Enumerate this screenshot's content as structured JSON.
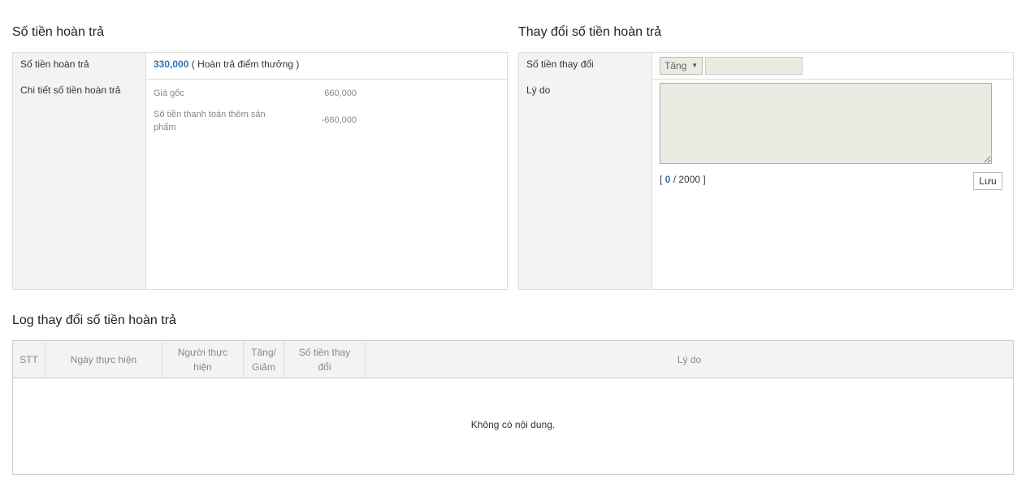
{
  "refund": {
    "title": "Số tiền hoàn trả",
    "amount_label": "Số tiền hoàn trả",
    "amount_value": "330,000",
    "amount_note": "( Hoàn trả điểm thưởng )",
    "detail_label": "Chi tiết số tiền hoàn trả",
    "details": [
      {
        "label": "Giá gốc",
        "value": "660,000"
      },
      {
        "label": "Số tiền thanh toán thêm sản phẩm",
        "value": "-660,000"
      }
    ]
  },
  "change": {
    "title": "Thay đổi số tiền hoàn trả",
    "amount_label": "Số tiền thay đổi",
    "direction_selected": "Tăng",
    "amount_input_value": "",
    "reason_label": "Lý do",
    "reason_value": "",
    "counter_current": "0",
    "counter_max": "2000",
    "save_label": "Lưu"
  },
  "log": {
    "title": "Log thay đổi số tiền hoàn trả",
    "columns": [
      "STT",
      "Ngày thực hiện",
      "Người thực hiện",
      "Tăng/ Giảm",
      "Số tiền thay đổi",
      "Lý do"
    ],
    "empty_text": "Không có nội dung."
  }
}
